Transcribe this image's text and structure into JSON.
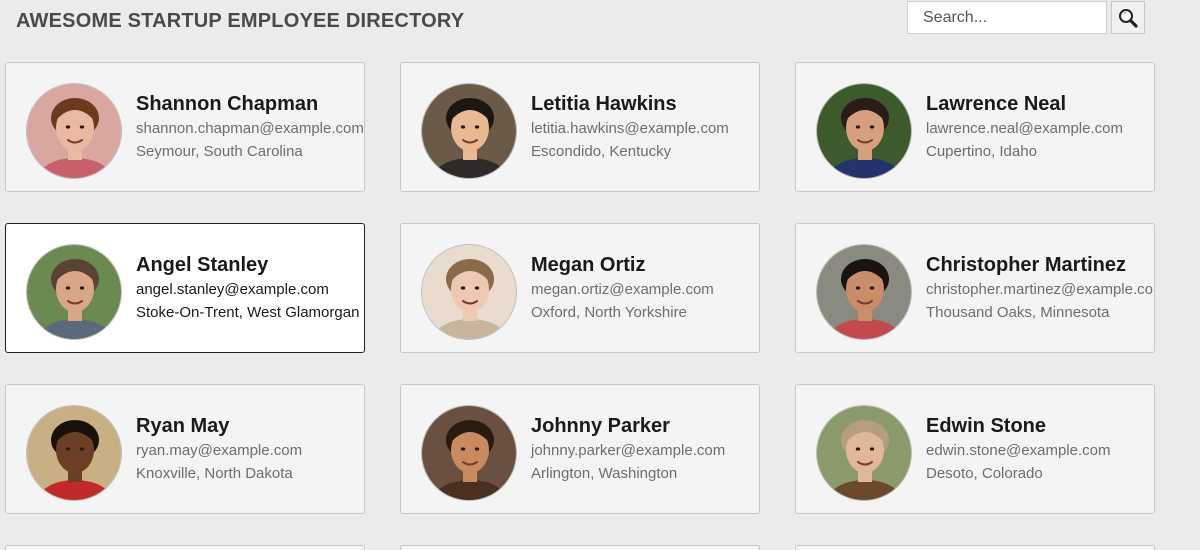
{
  "header": {
    "title": "AWESOME STARTUP EMPLOYEE DIRECTORY",
    "search_placeholder": "Search...",
    "search_icon": "magnifier-icon"
  },
  "employees": [
    {
      "name": "Shannon Chapman",
      "email": "shannon.chapman@example.com",
      "location": "Seymour, South Carolina",
      "skin": "#e9b9a1",
      "hair": "#6b3a1f",
      "bg": "#d9a7a0",
      "shirt": "#c95f6a"
    },
    {
      "name": "Letitia Hawkins",
      "email": "letitia.hawkins@example.com",
      "location": "Escondido, Kentucky",
      "skin": "#e8b993",
      "hair": "#1d1713",
      "bg": "#6c5a48",
      "shirt": "#2e2a2a"
    },
    {
      "name": "Lawrence Neal",
      "email": "lawrence.neal@example.com",
      "location": "Cupertino, Idaho",
      "skin": "#d6a07f",
      "hair": "#2a1c16",
      "bg": "#3c5a2c",
      "shirt": "#23336b"
    },
    {
      "name": "Angel Stanley",
      "email": "angel.stanley@example.com",
      "location": "Stoke-On-Trent, West Glamorgan",
      "skin": "#d9a788",
      "hair": "#5a4334",
      "bg": "#6b8a52",
      "shirt": "#5a6a7a"
    },
    {
      "name": "Megan Ortiz",
      "email": "megan.ortiz@example.com",
      "location": "Oxford, North Yorkshire",
      "skin": "#efc8b2",
      "hair": "#8a6a4a",
      "bg": "#e9dccf",
      "shirt": "#c9b59e"
    },
    {
      "name": "Christopher Martinez",
      "email": "christopher.martinez@example.com",
      "location": "Thousand Oaks, Minnesota",
      "skin": "#c98d6a",
      "hair": "#1a1410",
      "bg": "#8a8a80",
      "shirt": "#c24a4f"
    },
    {
      "name": "Ryan May",
      "email": "ryan.may@example.com",
      "location": "Knoxville, North Dakota",
      "skin": "#6a3f26",
      "hair": "#1a100a",
      "bg": "#c9b084",
      "shirt": "#c22a2a"
    },
    {
      "name": "Johnny Parker",
      "email": "johnny.parker@example.com",
      "location": "Arlington, Washington",
      "skin": "#c98a60",
      "hair": "#2a1a10",
      "bg": "#6a5040",
      "shirt": "#4a3020"
    },
    {
      "name": "Edwin Stone",
      "email": "edwin.stone@example.com",
      "location": "Desoto, Colorado",
      "skin": "#e0b79a",
      "hair": "#b89c80",
      "bg": "#8a9a6a",
      "shirt": "#6a4a2a"
    }
  ],
  "selected_index": 3
}
